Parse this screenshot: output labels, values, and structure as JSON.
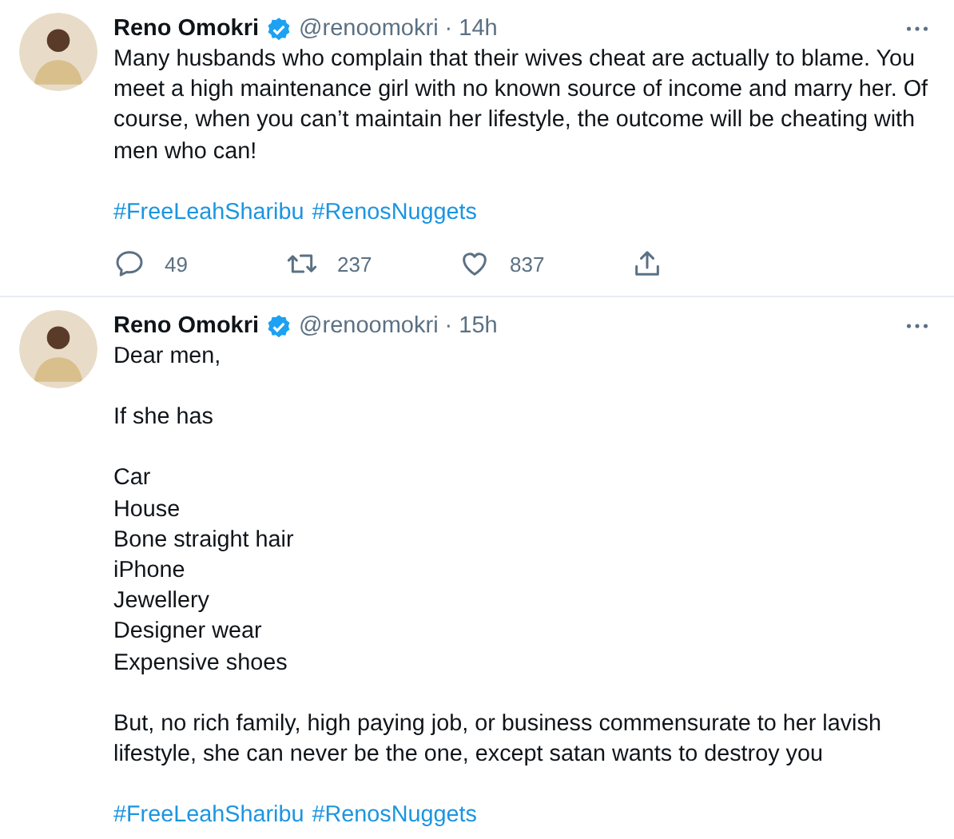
{
  "tweets": [
    {
      "name": "Reno Omokri",
      "verified": true,
      "handle": "@renoomokri",
      "separator": "·",
      "time": "14h",
      "paragraphs": [
        "Many husbands who complain that their wives cheat are actually to blame. You meet a high maintenance girl with no known source of income and marry her. Of course, when you can’t maintain her lifestyle, the outcome will be cheating with men who can!"
      ],
      "hashtags": [
        "#FreeLeahSharibu",
        "#RenosNuggets"
      ],
      "actions": [
        {
          "kind": "reply",
          "count": "49"
        },
        {
          "kind": "retweet",
          "count": "237"
        },
        {
          "kind": "like",
          "count": "837"
        },
        {
          "kind": "share"
        }
      ]
    },
    {
      "name": "Reno Omokri",
      "verified": true,
      "handle": "@renoomokri",
      "separator": "·",
      "time": "15h",
      "paragraphs": [
        "Dear men,",
        "If she has",
        "Car\nHouse\nBone straight hair\niPhone\nJewellery\nDesigner wear\nExpensive shoes",
        "But, no rich family, high paying job, or business commensurate to her lavish lifestyle, she can never be the one, except satan wants to destroy you"
      ],
      "hashtags": [
        "#FreeLeahSharibu",
        "#RenosNuggets"
      ]
    }
  ]
}
